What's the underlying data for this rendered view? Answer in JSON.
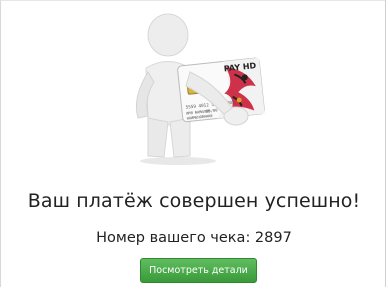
{
  "card": {
    "brand": "PAY HD",
    "number": "5559 4012 5617 7901",
    "holder": "ИМЯ ФАМИЛИЯ",
    "expiry": "55/00",
    "label": "НАИМЕНОВАНИЕ"
  },
  "message": {
    "title": "Ваш платёж совершен успешно!",
    "receipt": "Номер вашего чека: 2897"
  },
  "actions": {
    "details_label": "Посмотреть детали"
  },
  "colors": {
    "button_green": "#43a843",
    "card_red": "#c8102e"
  }
}
